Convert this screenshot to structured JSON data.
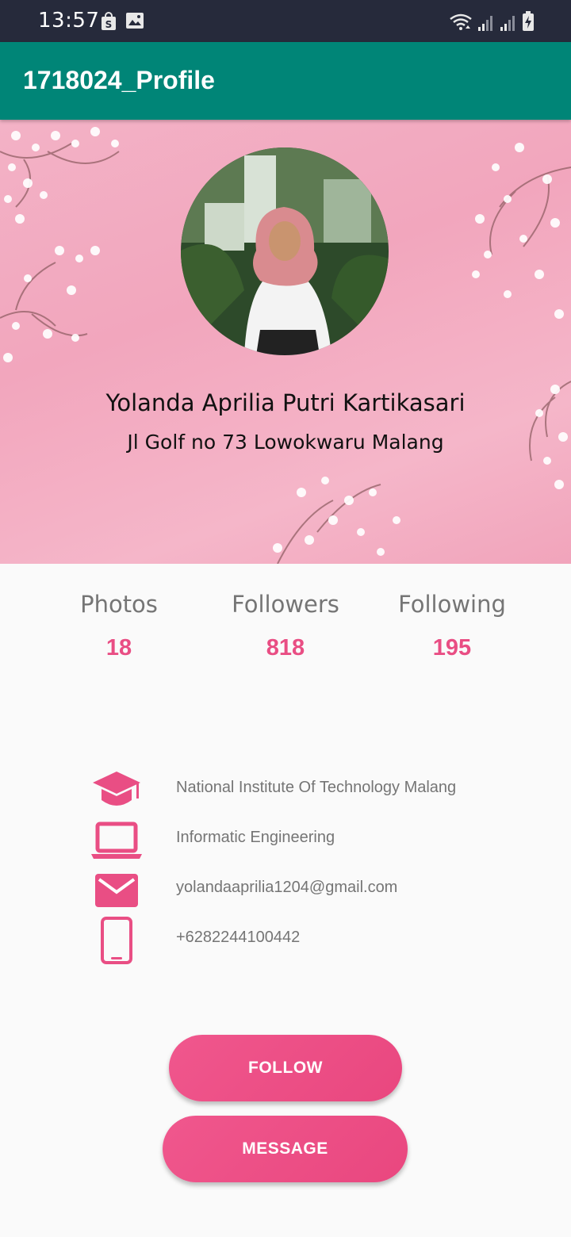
{
  "status_bar": {
    "time": "13:57",
    "left_icons": [
      "shopping-bag-icon",
      "image-icon"
    ],
    "right_icons": [
      "wifi-icon",
      "signal-icon",
      "signal-icon",
      "battery-charging-icon"
    ]
  },
  "app_bar": {
    "title": "1718024_Profile",
    "color": "#008577"
  },
  "profile": {
    "name": "Yolanda Aprilia Putri Kartikasari",
    "address": "Jl Golf no 73 Lowokwaru Malang"
  },
  "stats": [
    {
      "label": "Photos",
      "value": "18"
    },
    {
      "label": "Followers",
      "value": "818"
    },
    {
      "label": "Following",
      "value": "195"
    }
  ],
  "info": [
    {
      "icon": "graduation-cap-icon",
      "text": "National Institute Of Technology Malang"
    },
    {
      "icon": "laptop-icon",
      "text": "Informatic Engineering"
    },
    {
      "icon": "email-icon",
      "text": "yolandaaprilia1204@gmail.com"
    },
    {
      "icon": "phone-icon",
      "text": "+6282244100442"
    }
  ],
  "buttons": {
    "follow": "FOLLOW",
    "message": "MESSAGE"
  },
  "colors": {
    "accent": "#e94e84",
    "header_pink": "#f3b2c6",
    "status_bar": "#262a3b"
  }
}
